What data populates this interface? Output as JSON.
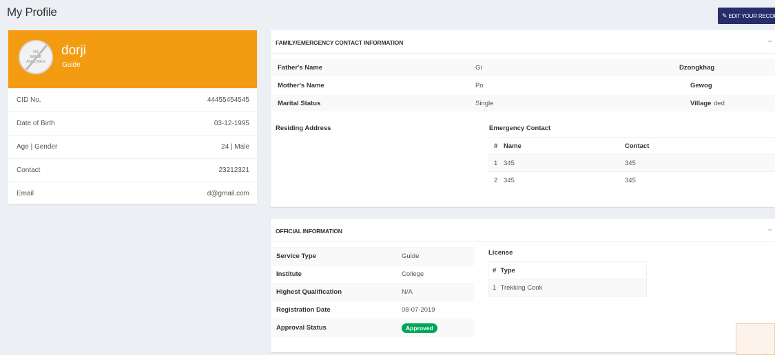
{
  "page": {
    "title": "My Profile",
    "edit_button": "EDIT YOUR RECORD"
  },
  "profile": {
    "name": "dorji",
    "role": "Guide",
    "avatar_text": [
      "NO",
      "IMAGE",
      "AVAILABLE"
    ],
    "fields": [
      {
        "label": "CID No.",
        "value": "44455454545"
      },
      {
        "label": "Date of Birth",
        "value": "03-12-1995"
      },
      {
        "label": "Age | Gender",
        "value": "24 | Male"
      },
      {
        "label": "Contact",
        "value": "23212321"
      },
      {
        "label": "Email",
        "value": "d@gmail.com"
      }
    ]
  },
  "family": {
    "title": "FAMILY/EMERGENCY CONTACT INFORMATION",
    "collapse": "−",
    "rows": [
      {
        "label": "Father's Name",
        "value": "Gi",
        "right_label": "Dzongkhag",
        "right_value": ""
      },
      {
        "label": "Mother's Name",
        "value": "Po",
        "right_label": "Gewog",
        "right_value": ""
      },
      {
        "label": "Marital Status",
        "value": "Single",
        "right_label": "Village",
        "right_value": "ded"
      }
    ],
    "residing_address_label": "Residing Address",
    "emergency_label": "Emergency Contact",
    "emergency_headers": [
      "#",
      "Name",
      "Contact"
    ],
    "emergency_rows": [
      [
        "1",
        "345",
        "345"
      ],
      [
        "2",
        "345",
        "345"
      ]
    ]
  },
  "official": {
    "title": "OFFICIAL INFORMATION",
    "collapse": "−",
    "rows": [
      {
        "label": "Service Type",
        "value": "Guide"
      },
      {
        "label": "Institute",
        "value": "College"
      },
      {
        "label": "Highest Qualification",
        "value": "N/A"
      },
      {
        "label": "Registration Date",
        "value": "08-07-2019"
      },
      {
        "label": "Approval Status",
        "value": "Approved"
      }
    ],
    "license_label": "License",
    "license_headers": [
      "#",
      "Type"
    ],
    "license_rows": [
      [
        "1",
        "Trekking Cook"
      ]
    ]
  },
  "colors": {
    "accent_orange": "#f39c12",
    "edit_button": "#272d6b",
    "approved_badge": "#00a65a",
    "background": "#ecf0f5"
  }
}
